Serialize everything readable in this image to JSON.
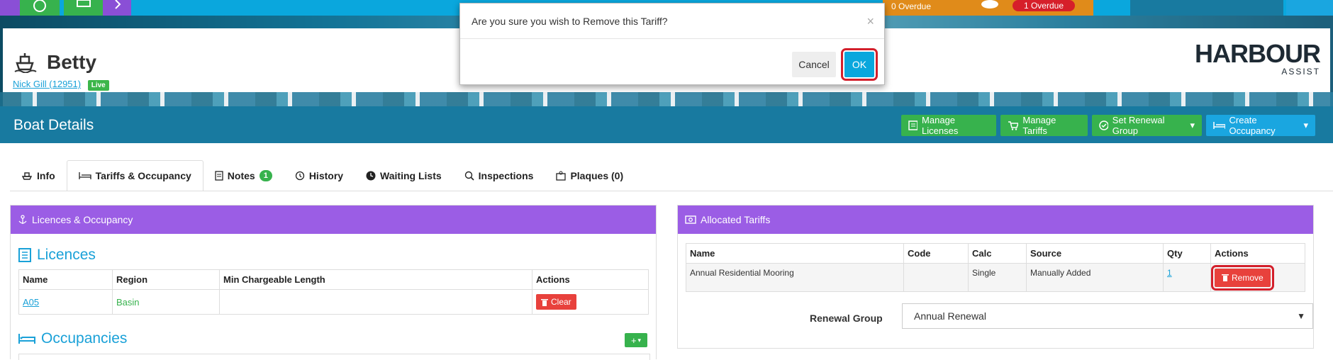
{
  "modal": {
    "question": "Are you sure you wish to Remove this Tariff?",
    "cancel": "Cancel",
    "ok": "OK",
    "close": "×"
  },
  "topbar": {
    "overdue_a": "0 Overdue",
    "overdue_b": "1 Overdue"
  },
  "header": {
    "boat_name": "Betty",
    "owner_link": "Nick Gill (12951)",
    "status": "Live",
    "logo_main": "HARBOUR",
    "logo_sub": "ASSIST"
  },
  "details_bar": {
    "title": "Boat Details",
    "buttons": [
      "Manage Licenses",
      "Manage Tariffs",
      "Set Renewal Group",
      "Create Occupancy"
    ]
  },
  "tabs": [
    {
      "label": "Info"
    },
    {
      "label": "Tariffs & Occupancy"
    },
    {
      "label": "Notes",
      "count": "1"
    },
    {
      "label": "History"
    },
    {
      "label": "Waiting Lists"
    },
    {
      "label": "Inspections"
    },
    {
      "label": "Plaques (0)"
    }
  ],
  "left_panel": {
    "title": "Licences & Occupancy",
    "licences_title": "Licences",
    "licence_headers": [
      "Name",
      "Region",
      "Min Chargeable Length",
      "Actions"
    ],
    "licence_rows": [
      {
        "name": "A05",
        "region": "Basin",
        "min_len": "",
        "action": "Clear"
      }
    ],
    "occupancies_title": "Occupancies",
    "add_label": "+"
  },
  "right_panel": {
    "title": "Allocated Tariffs",
    "headers": [
      "Name",
      "Code",
      "Calc",
      "Source",
      "Qty",
      "Actions"
    ],
    "rows": [
      {
        "name": "Annual Residential Mooring",
        "code": "",
        "calc": "Single",
        "source": "Manually Added",
        "qty": "1",
        "action": "Remove"
      }
    ],
    "renewal_label": "Renewal Group",
    "renewal_value": "Annual Renewal"
  },
  "colors": {
    "accent": "#0aa7dd",
    "panel_header": "#9b5de5",
    "details_bar": "#187aa0",
    "green": "#37b24d",
    "danger": "#e8413c"
  }
}
